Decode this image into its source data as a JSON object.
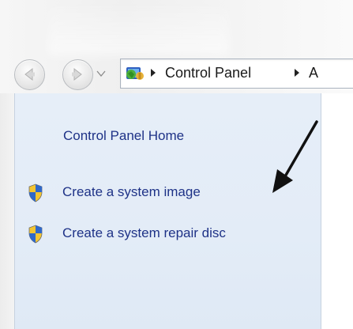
{
  "window": {
    "breadcrumbs": [
      "Control Panel",
      "A"
    ]
  },
  "navigation": {
    "back_icon": "back-arrow-icon",
    "forward_icon": "forward-arrow-icon",
    "recent_icon": "chevron-down-icon",
    "location_icon": "control-panel-icon"
  },
  "sidebar": {
    "home_label": "Control Panel Home",
    "tasks": [
      {
        "label": "Create a system image",
        "icon": "uac-shield-icon"
      },
      {
        "label": "Create a system repair disc",
        "icon": "uac-shield-icon"
      }
    ],
    "annotation": "black-arrow-pointer"
  },
  "colors": {
    "link": "#1e3287",
    "pane_background": "#e4edf8",
    "shield_blue": "#2f68c9",
    "shield_yellow": "#f3c531"
  }
}
